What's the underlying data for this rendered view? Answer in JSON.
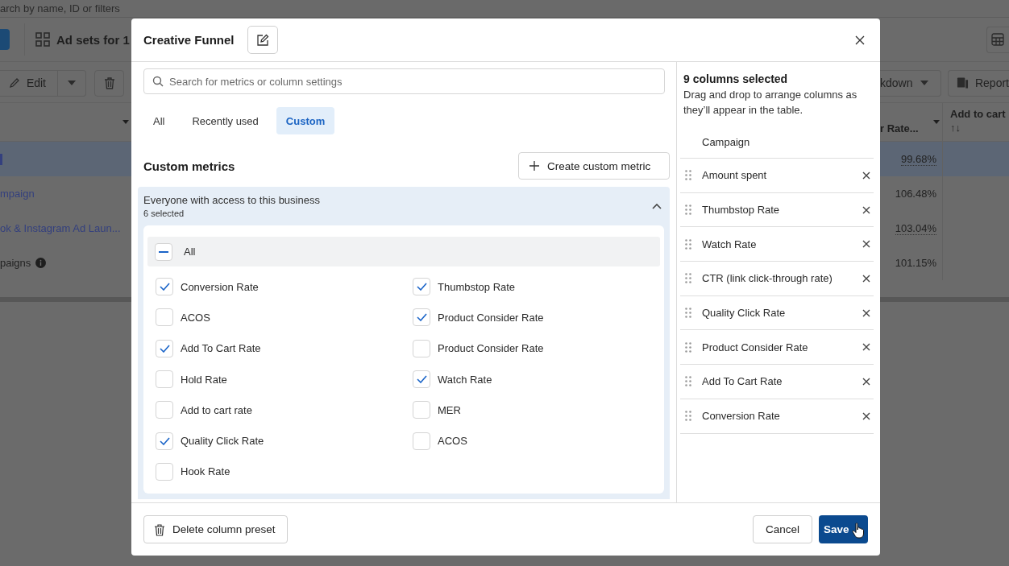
{
  "background": {
    "search_text": "arch by name, ID or filters",
    "title": "Ad sets for 1",
    "edit_button": "Edit",
    "breakdown_button": "kdown",
    "reports_button": "Report",
    "columns": [
      {
        "label": "r Rate..."
      },
      {
        "label": "Add to cart",
        "sort": "↑↓"
      }
    ],
    "rows": [
      {
        "name": "",
        "value": "99.68%",
        "selected": true,
        "kind": "link"
      },
      {
        "name": "mpaign",
        "value": "106.48%",
        "selected": false,
        "kind": "link"
      },
      {
        "name": "ok & Instagram Ad Laun...",
        "value": "103.04%",
        "selected": false,
        "kind": "link"
      },
      {
        "name": "paigns",
        "value": "101.15%",
        "selected": false,
        "kind": "total"
      }
    ]
  },
  "modal": {
    "title": "Creative Funnel",
    "search": {
      "placeholder": "Search for metrics or column settings"
    },
    "tabs": [
      {
        "label": "All",
        "selected": false
      },
      {
        "label": "Recently used",
        "selected": false
      },
      {
        "label": "Custom",
        "selected": true
      }
    ],
    "section_title": "Custom metrics",
    "create_button": "Create custom metric",
    "group": {
      "title": "Everyone with access to this business",
      "count": "6 selected",
      "expanded": true,
      "all": {
        "label": "All",
        "indeterminate": true
      },
      "metrics": [
        {
          "label": "Conversion Rate",
          "checked": true
        },
        {
          "label": "Thumbstop Rate",
          "checked": true
        },
        {
          "label": "ACOS",
          "checked": false
        },
        {
          "label": "Product Consider Rate",
          "checked": true
        },
        {
          "label": "Add To Cart Rate",
          "checked": true
        },
        {
          "label": "Product Consider Rate",
          "checked": false
        },
        {
          "label": "Hold Rate",
          "checked": false
        },
        {
          "label": "Watch Rate",
          "checked": true
        },
        {
          "label": "Add to cart rate",
          "checked": false
        },
        {
          "label": "MER",
          "checked": false
        },
        {
          "label": "Quality Click Rate",
          "checked": true
        },
        {
          "label": "ACOS",
          "checked": false
        },
        {
          "label": "Hook Rate",
          "checked": false
        }
      ]
    },
    "selected_title": "9 columns selected",
    "hint": "Drag and drop to arrange columns as they’ll appear in the table.",
    "columns": [
      {
        "label": "Campaign",
        "locked": true
      },
      {
        "label": "Amount spent",
        "locked": false
      },
      {
        "label": "Thumbstop Rate",
        "locked": false
      },
      {
        "label": "Watch Rate",
        "locked": false
      },
      {
        "label": "CTR (link click-through rate)",
        "locked": false
      },
      {
        "label": "Quality Click Rate",
        "locked": false
      },
      {
        "label": "Product Consider Rate",
        "locked": false
      },
      {
        "label": "Add To Cart Rate",
        "locked": false
      },
      {
        "label": "Conversion Rate",
        "locked": false
      }
    ],
    "delete_button": "Delete column preset",
    "cancel_button": "Cancel",
    "save_button": "Save"
  }
}
